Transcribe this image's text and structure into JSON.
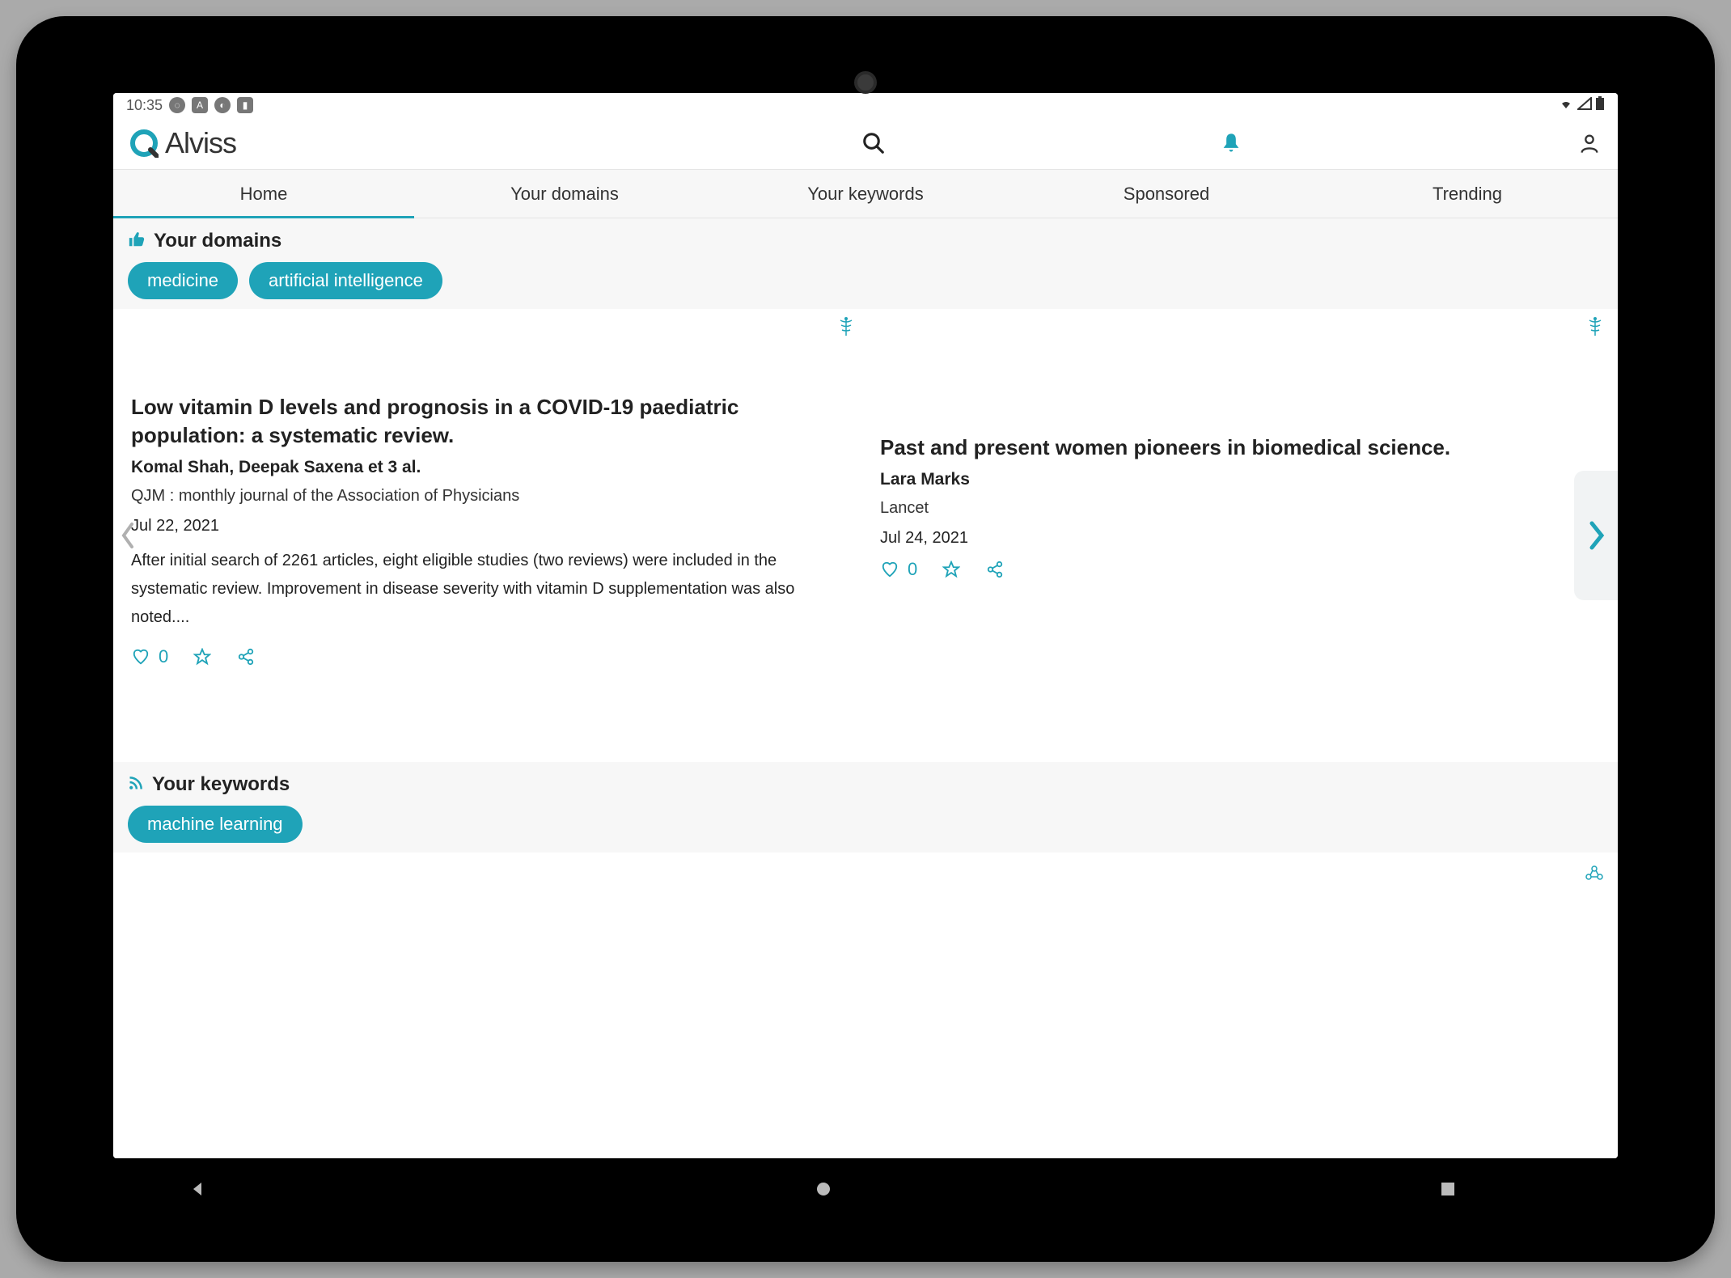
{
  "status": {
    "time": "10:35"
  },
  "brand": {
    "name": "Alviss"
  },
  "tabs": [
    {
      "label": "Home",
      "active": true
    },
    {
      "label": "Your domains",
      "active": false
    },
    {
      "label": "Your keywords",
      "active": false
    },
    {
      "label": "Sponsored",
      "active": false
    },
    {
      "label": "Trending",
      "active": false
    }
  ],
  "domains_section": {
    "title": "Your domains",
    "chips": [
      "medicine",
      "artificial intelligence"
    ]
  },
  "cards": [
    {
      "title": "Low vitamin D levels and prognosis in a COVID-19 paediatric population: a systematic review.",
      "authors": "Komal Shah, Deepak Saxena et 3 al.",
      "journal": "QJM : monthly journal of the Association of Physicians",
      "date": "Jul 22, 2021",
      "abstract": "After initial search of 2261 articles, eight eligible studies (two reviews) were included in the systematic review. Improvement in disease severity with vitamin D supplementation was also noted....",
      "likes": "0"
    },
    {
      "title": "Past and present women pioneers in biomedical science.",
      "authors": "Lara Marks",
      "journal": "Lancet",
      "date": "Jul 24, 2021",
      "abstract": "",
      "likes": "0"
    }
  ],
  "keywords_section": {
    "title": "Your keywords",
    "chips": [
      "machine learning"
    ]
  },
  "colors": {
    "accent": "#1fa3b8"
  }
}
